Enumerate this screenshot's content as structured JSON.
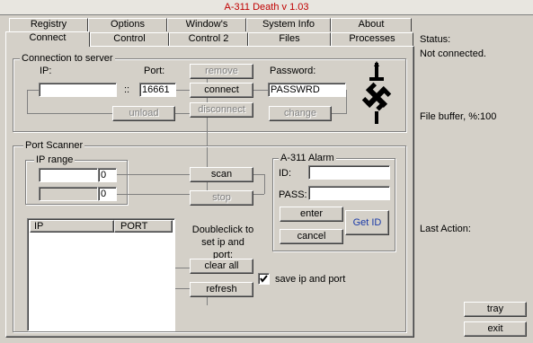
{
  "window": {
    "title": "A-311 Death v 1.03"
  },
  "tabs_row1": [
    "Registry",
    "Options",
    "Window's",
    "System Info",
    "About"
  ],
  "tabs_row2": [
    "Connect",
    "Control",
    "Control 2",
    "Files",
    "Processes"
  ],
  "connection": {
    "group_label": "Connection to server",
    "ip_label": "IP:",
    "ip_value": "",
    "ip_separator": "::",
    "port_label": "Port:",
    "port_value": "16661",
    "password_label": "Password:",
    "password_value": "PASSWRD",
    "remove_label": "remove",
    "connect_label": "connect",
    "disconnect_label": "disconnect",
    "unload_label": "unload",
    "change_label": "change"
  },
  "scanner": {
    "group_label": "Port Scanner",
    "ip_range_label": "IP range",
    "range_start_ip": "",
    "range_start_num": "0",
    "range_end_ip": "",
    "range_end_num": "0",
    "scan_label": "scan",
    "stop_label": "stop",
    "list_headers": [
      "IP",
      "PORT"
    ],
    "hint": "Doubleclick to set ip and port:",
    "clear_label": "clear all",
    "refresh_label": "refresh",
    "save_checkbox_label": "save ip and port",
    "save_checked": true
  },
  "alarm": {
    "group_label": "A-311 Alarm",
    "id_label": "ID:",
    "id_value": "",
    "pass_label": "PASS:",
    "pass_value": "",
    "enter_label": "enter",
    "cancel_label": "cancel",
    "get_id_label": "Get ID"
  },
  "status": {
    "label": "Status:",
    "value": "Not connected.",
    "buffer_label": "File buffer, %:",
    "buffer_value": "100",
    "last_action_label": "Last Action:"
  },
  "bottom": {
    "tray_label": "tray",
    "exit_label": "exit"
  }
}
